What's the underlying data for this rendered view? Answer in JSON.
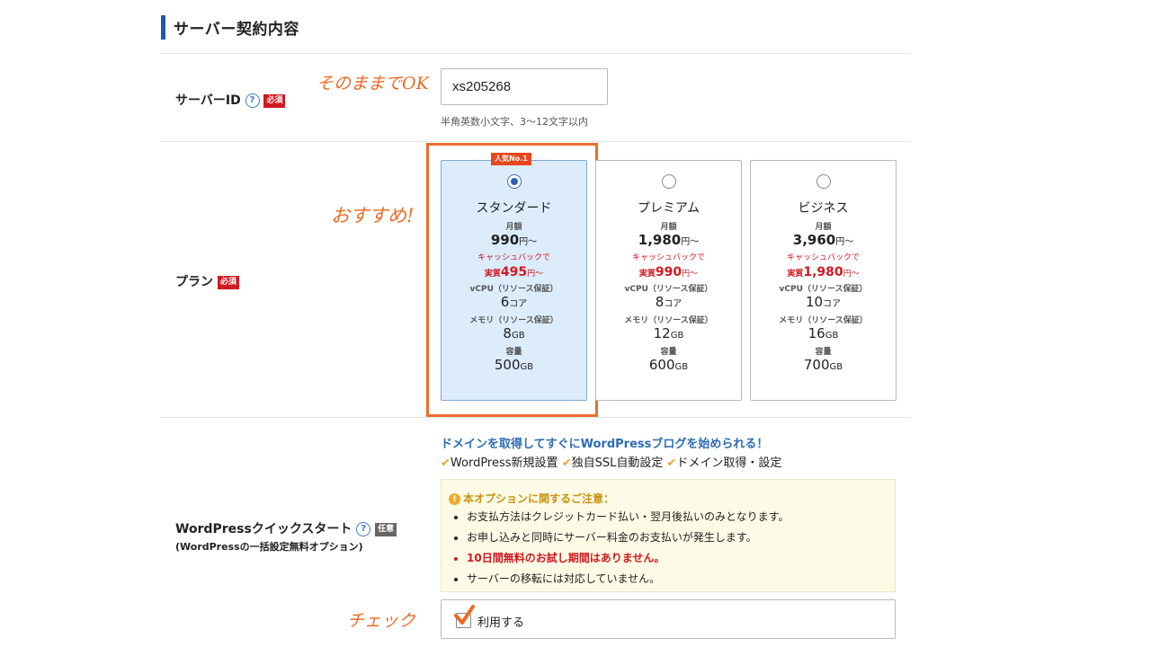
{
  "section": {
    "title": "サーバー契約内容"
  },
  "server_id": {
    "label": "サーバーID",
    "help": "?",
    "required": "必須",
    "value": "xs205268",
    "hint": "半角英数小文字、3〜12文字以内"
  },
  "annotations": {
    "ok": "そのままでOK",
    "recommend": "おすすめ!",
    "check": "チェック"
  },
  "plan": {
    "label": "プラン",
    "required": "必須",
    "popular_badge": "人気No.1",
    "items": [
      {
        "name": "スタンダード",
        "monthly_label": "月額",
        "price": "990",
        "price_unit": "円〜",
        "cashback_label": "キャッシュバックで",
        "actual_prefix": "実質",
        "actual_price": "495",
        "actual_unit": "円〜",
        "vcpu_label": "vCPU（リソース保証）",
        "vcpu": "6",
        "vcpu_unit": "コア",
        "mem_label": "メモリ（リソース保証）",
        "mem": "8",
        "mem_unit": "GB",
        "disk_label": "容量",
        "disk": "500",
        "disk_unit": "GB",
        "selected": true
      },
      {
        "name": "プレミアム",
        "monthly_label": "月額",
        "price": "1,980",
        "price_unit": "円〜",
        "cashback_label": "キャッシュバックで",
        "actual_prefix": "実質",
        "actual_price": "990",
        "actual_unit": "円〜",
        "vcpu_label": "vCPU（リソース保証）",
        "vcpu": "8",
        "vcpu_unit": "コア",
        "mem_label": "メモリ（リソース保証）",
        "mem": "12",
        "mem_unit": "GB",
        "disk_label": "容量",
        "disk": "600",
        "disk_unit": "GB",
        "selected": false
      },
      {
        "name": "ビジネス",
        "monthly_label": "月額",
        "price": "3,960",
        "price_unit": "円〜",
        "cashback_label": "キャッシュバックで",
        "actual_prefix": "実質",
        "actual_price": "1,980",
        "actual_unit": "円〜",
        "vcpu_label": "vCPU（リソース保証）",
        "vcpu": "10",
        "vcpu_unit": "コア",
        "mem_label": "メモリ（リソース保証）",
        "mem": "16",
        "mem_unit": "GB",
        "disk_label": "容量",
        "disk": "700",
        "disk_unit": "GB",
        "selected": false
      }
    ]
  },
  "wordpress": {
    "label": "WordPressクイックスタート",
    "help": "?",
    "optional": "任意",
    "sublabel": "(WordPressの一括設定無料オプション)",
    "promo": "ドメインを取得してすぐにWordPressブログを始められる！",
    "features": [
      "WordPress新規設置",
      "独自SSL自動設定",
      "ドメイン取得・設定"
    ],
    "notice_title": "本オプションに関するご注意：",
    "notices": [
      "お支払方法はクレジットカード払い・翌月後払いのみとなります。",
      "お申し込みと同時にサーバー料金のお支払いが発生します。",
      "10日間無料のお試し期間はありません。",
      "サーバーの移転には対応していません。"
    ],
    "use_label": "利用する",
    "use_checked": true
  },
  "colors": {
    "accent": "#1f5ba6",
    "required": "#d11920",
    "highlight": "#ef6c2d",
    "annotation": "#ec6b24"
  }
}
